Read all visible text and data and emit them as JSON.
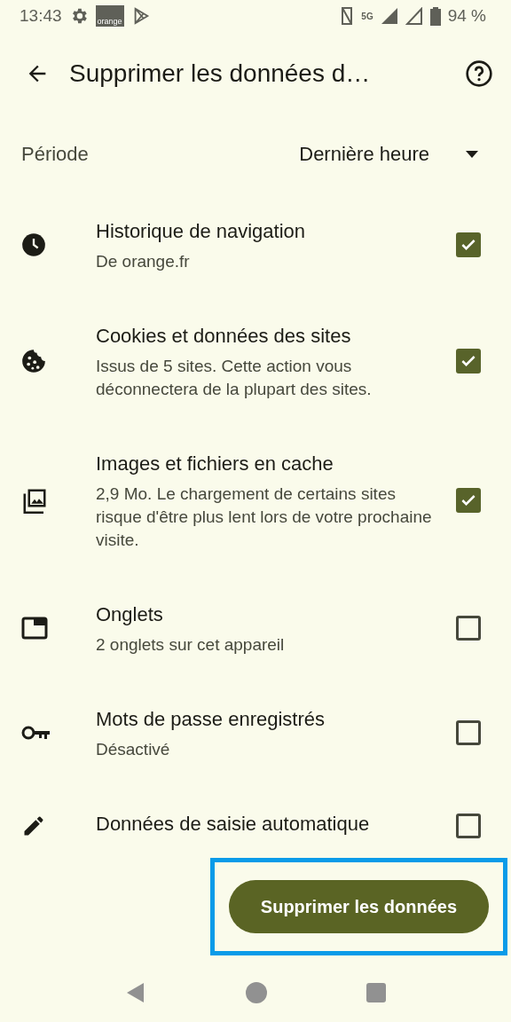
{
  "status_bar": {
    "time": "13:43",
    "logo_text": "orange",
    "network": "5G",
    "battery": "94 %"
  },
  "toolbar": {
    "title": "Supprimer les données d…"
  },
  "period": {
    "label": "Période",
    "value": "Dernière heure"
  },
  "items": [
    {
      "kind": "clock",
      "title": "Historique de navigation",
      "subtitle": "De orange.fr",
      "checked": true
    },
    {
      "kind": "cookie",
      "title": "Cookies et données des sites",
      "subtitle": "Issus de 5 sites. Cette action vous déconnectera de la plupart des sites.",
      "checked": true
    },
    {
      "kind": "image",
      "title": "Images et fichiers en cache",
      "subtitle": "2,9 Mo. Le chargement de certains sites risque d'être plus lent lors de votre prochaine visite.",
      "checked": true
    },
    {
      "kind": "tab",
      "title": "Onglets",
      "subtitle": "2 onglets sur cet appareil",
      "checked": false
    },
    {
      "kind": "key",
      "title": "Mots de passe enregistrés",
      "subtitle": "Désactivé",
      "checked": false
    },
    {
      "kind": "pencil",
      "title": "Données de saisie automatique",
      "checked": false
    }
  ],
  "action": {
    "label": "Supprimer les données",
    "highlighted": true
  }
}
